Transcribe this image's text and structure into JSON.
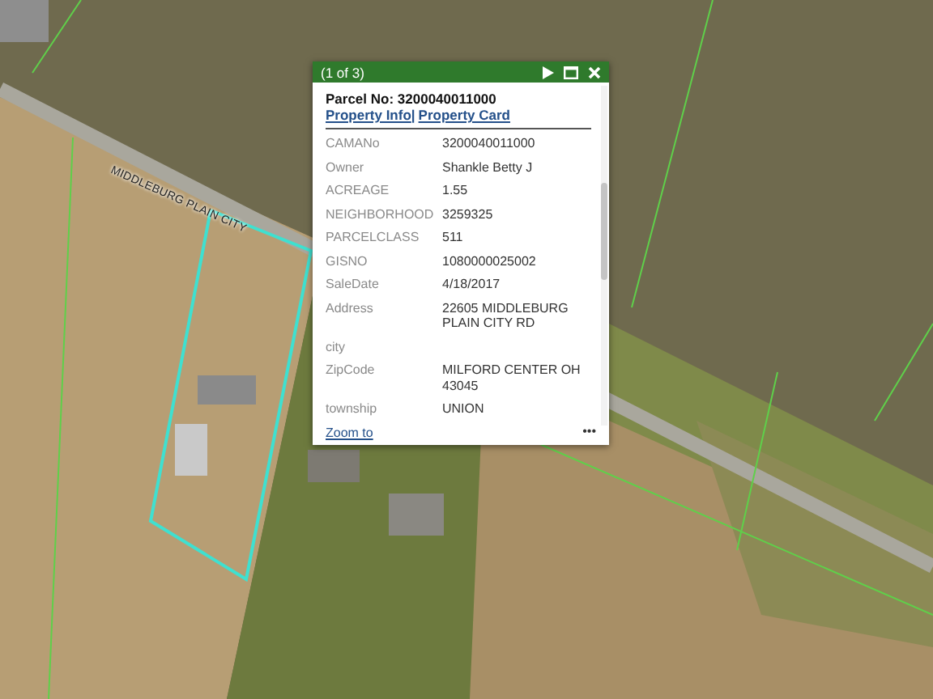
{
  "map": {
    "road_label": "MIDDLEBURG PLAIN CITY"
  },
  "popup": {
    "counter": "(1 of 3)",
    "title": "Parcel No: 3200040011000",
    "links": [
      "Property Info",
      "Property Card"
    ],
    "link_separator": "|",
    "fields": [
      {
        "label": "CAMANo",
        "value": "3200040011000"
      },
      {
        "label": "Owner",
        "value": "Shankle Betty J"
      },
      {
        "label": "ACREAGE",
        "value": "1.55"
      },
      {
        "label": "NEIGHBORHOOD",
        "value": "3259325"
      },
      {
        "label": "PARCELCLASS",
        "value": "511"
      },
      {
        "label": "GISNO",
        "value": "1080000025002"
      },
      {
        "label": "SaleDate",
        "value": "4/18/2017"
      },
      {
        "label": "Address",
        "value": "22605 MIDDLEBURG PLAIN CITY RD"
      },
      {
        "label": "city"
      },
      {
        "label": "ZipCode",
        "value": "MILFORD CENTER OH 43045"
      },
      {
        "label": "township",
        "value": "UNION"
      }
    ],
    "zoom_link": "Zoom to",
    "more": "•••"
  }
}
